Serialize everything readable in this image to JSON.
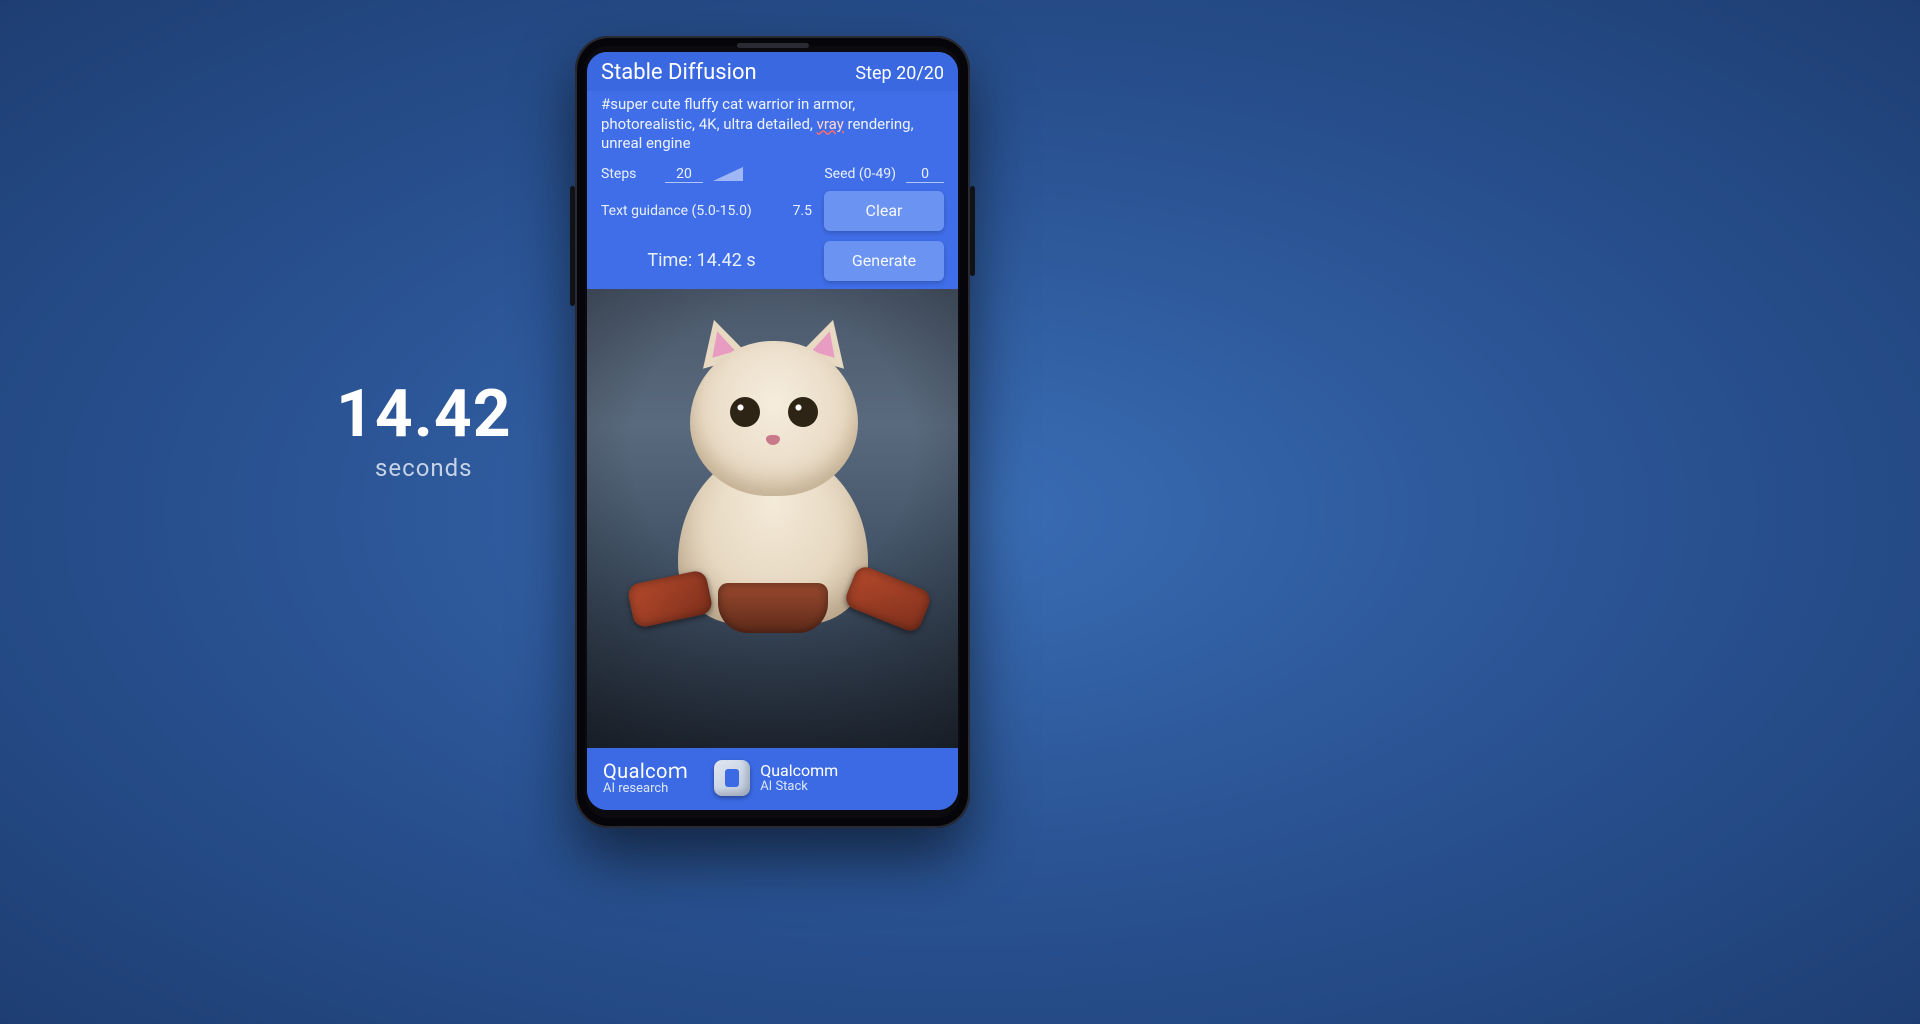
{
  "side_timer": {
    "value": "14.42",
    "unit": "seconds"
  },
  "app": {
    "title": "Stable Diffusion",
    "step_label": "Step 20/20",
    "prompt_pre": "#super cute fluffy cat warrior in armor, photorealistic, 4K, ultra detailed, ",
    "prompt_vray": "vray",
    "prompt_post": " rendering, unreal engine",
    "steps_label": "Steps",
    "steps_value": "20",
    "seed_label": "Seed (0-49)",
    "seed_value": "0",
    "tg_label": "Text guidance (5.0-15.0)",
    "tg_value": "7.5",
    "time_label": "Time: 14.42 s",
    "clear_label": "Clear",
    "generate_label": "Generate",
    "generated_image_desc": "fluffy cat warrior in armor"
  },
  "footer": {
    "research_brand": "Qualcoｍ",
    "research_sub": "AI research",
    "stack_brand": "Qualcomm",
    "stack_sub": "AI Stack"
  }
}
